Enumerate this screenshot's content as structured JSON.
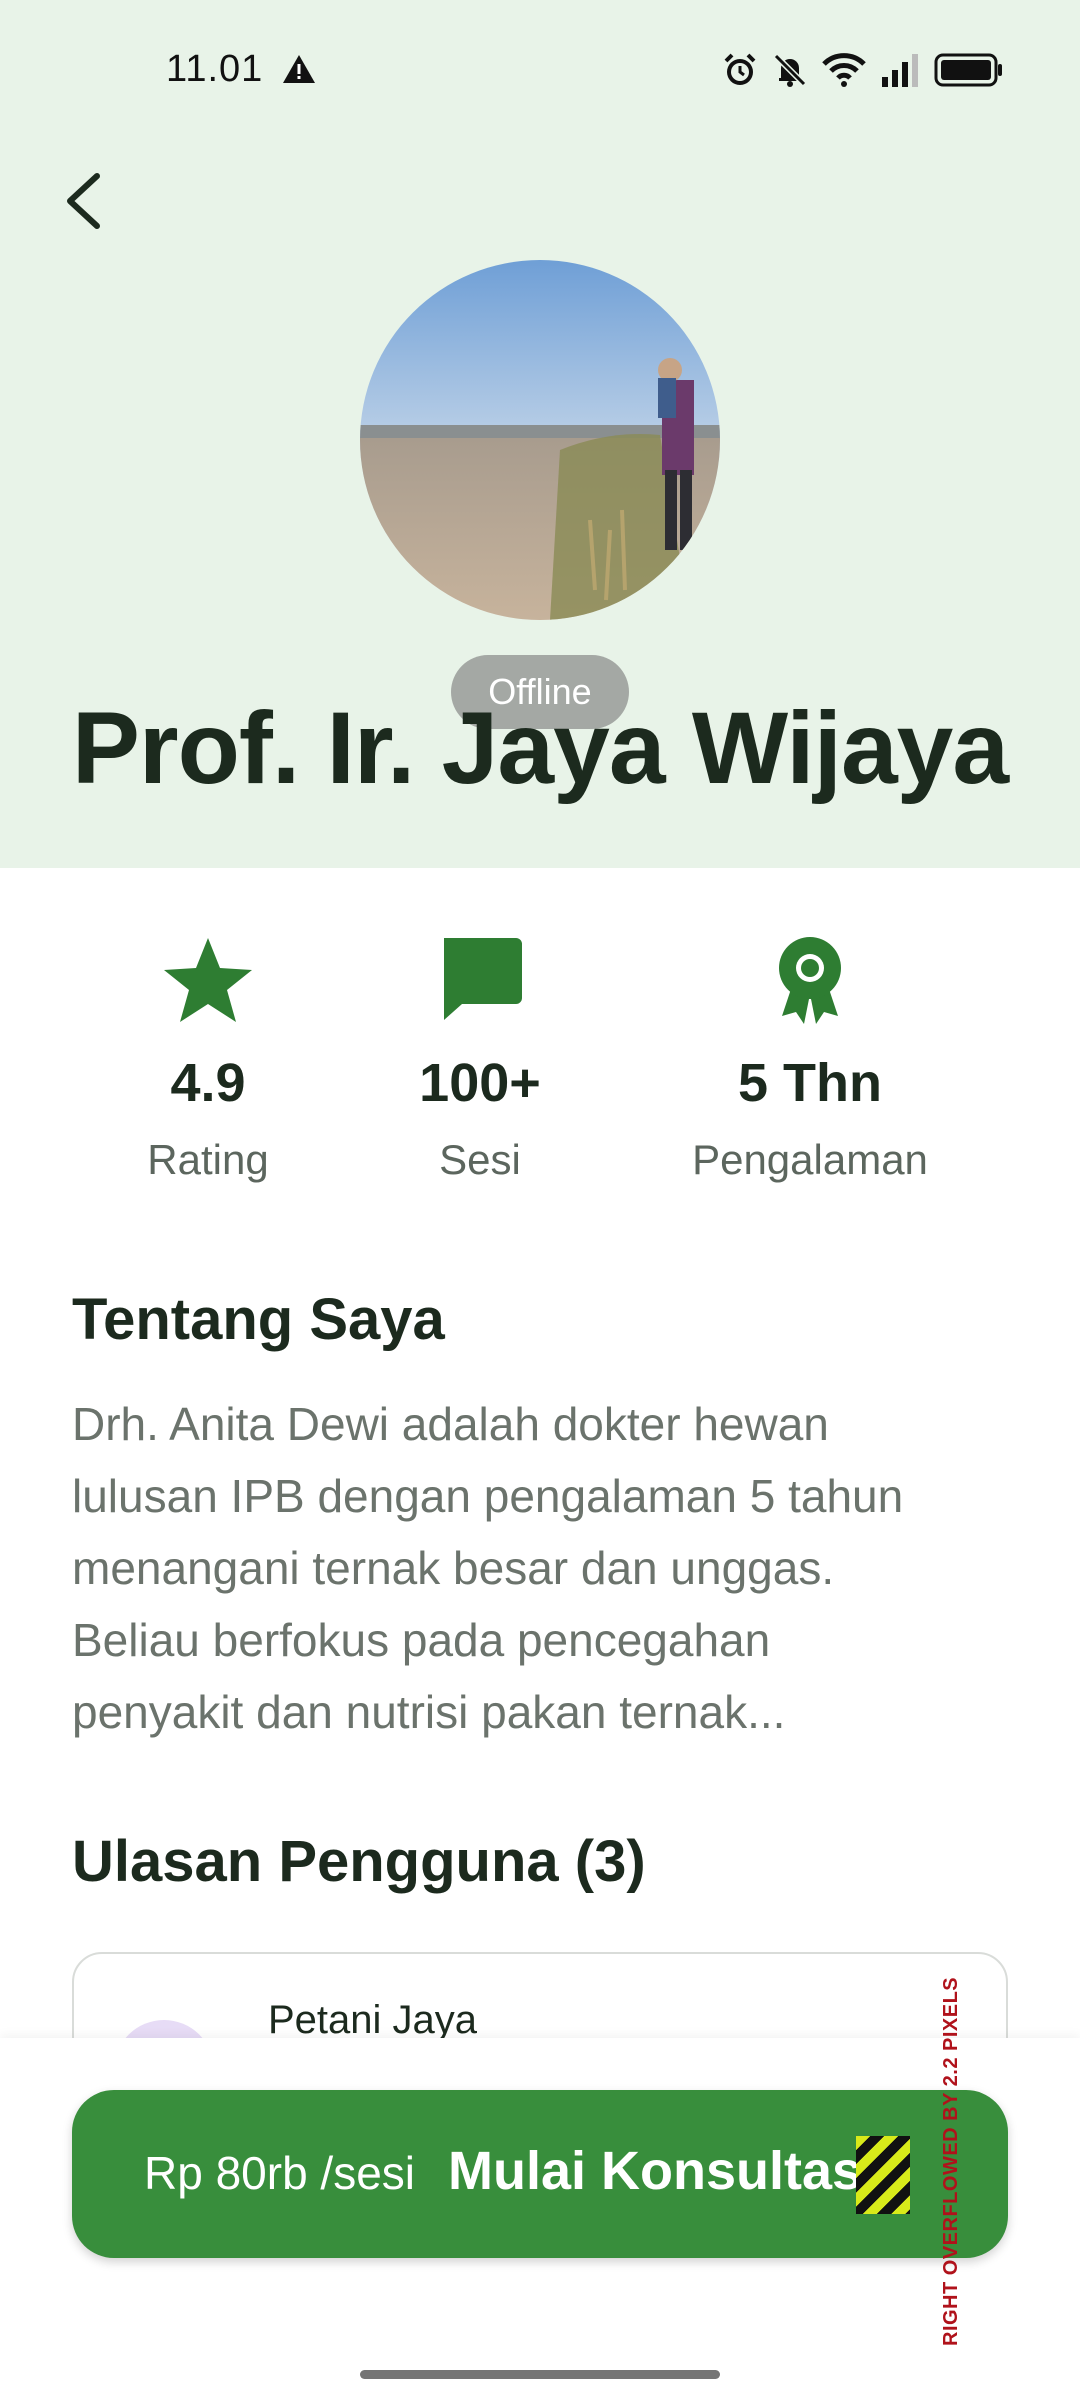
{
  "status_bar": {
    "time": "11.01",
    "icons": [
      "warning-icon",
      "alarm-icon",
      "mute-icon",
      "wifi-icon",
      "signal-icon",
      "battery-icon"
    ]
  },
  "header": {
    "back_icon": "back-arrow-icon",
    "status_badge": "Offline",
    "name": "Prof. Ir. Jaya Wijaya",
    "background_color": "#e8f3e8"
  },
  "stats": [
    {
      "icon": "star-icon",
      "value": "4.9",
      "label": "Rating"
    },
    {
      "icon": "chat-icon",
      "value": "100+",
      "label": "Sesi"
    },
    {
      "icon": "award-icon",
      "value": "5 Thn",
      "label": "Pengalaman"
    }
  ],
  "about": {
    "title": "Tentang Saya",
    "lines": [
      "Drh. Anita Dewi adalah dokter hewan",
      "lulusan IPB dengan pengalaman 5 tahun",
      "menangani ternak besar dan unggas.",
      "Beliau berfokus pada pencegahan",
      "penyakit dan nutrisi pakan ternak..."
    ]
  },
  "reviews": {
    "title": "Ulasan Pengguna (3)",
    "items": [
      {
        "name": "Petani Jaya"
      }
    ]
  },
  "cta": {
    "price": "Rp 80rb /sesi",
    "label": "Mulai Konsultasi",
    "overflow_warning": "RIGHT OVERFLOWED BY 2.2 PIXELS"
  },
  "colors": {
    "accent": "#388e3c",
    "icon_green": "#2e7d32",
    "name_text": "#1c2a1e",
    "muted_text": "#6b736c"
  }
}
